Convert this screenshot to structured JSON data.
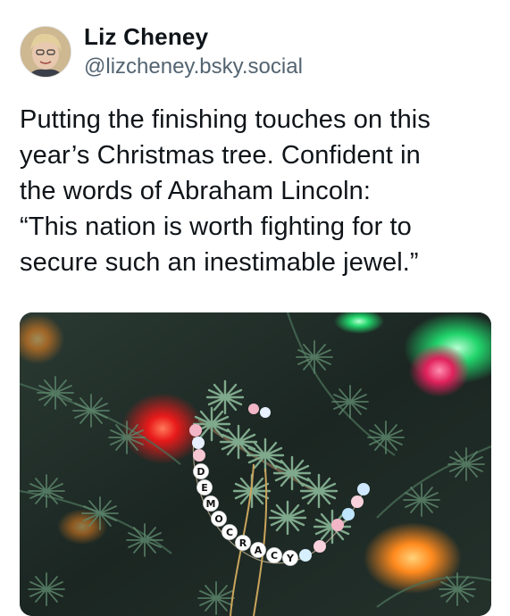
{
  "post": {
    "author": {
      "display_name": "Liz Cheney",
      "handle": "@lizcheney.bsky.social"
    },
    "text": "Putting the finishing touches on this\nyear’s Christmas tree. Confident in\nthe words of Abraham Lincoln:\n“This nation is worth fighting for to\nsecure such an inestimable jewel.”",
    "image": {
      "bracelet_letters": [
        "D",
        "E",
        "M",
        "O",
        "C",
        "R",
        "A",
        "C",
        "Y"
      ]
    }
  }
}
